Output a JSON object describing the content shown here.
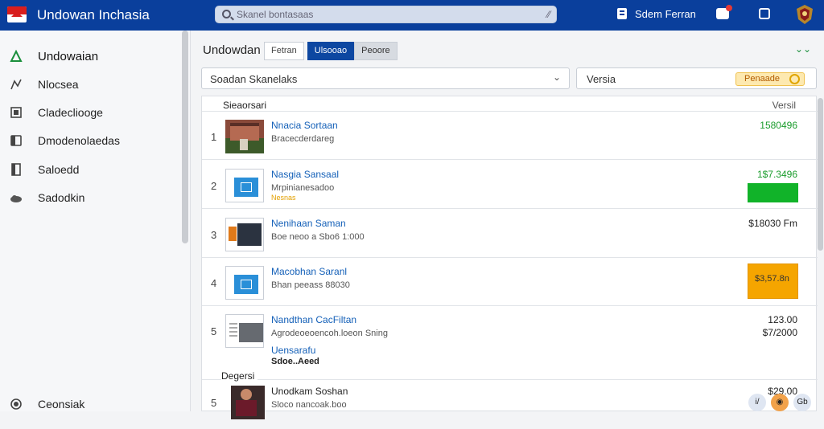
{
  "app": {
    "title": "Undowan Inchasia"
  },
  "search": {
    "placeholder": "Skanel bontasaas",
    "mic_label": "⁄⁄"
  },
  "top_actions": {
    "user_label": "Sdem Ferran"
  },
  "sidebar": {
    "items": [
      {
        "label": "Undowaian",
        "icon": "home-icon",
        "active": true
      },
      {
        "label": "Nlocsea",
        "icon": "chart-icon"
      },
      {
        "label": "Cladecliooge",
        "icon": "box-icon"
      },
      {
        "label": "Dmodenolaedas",
        "icon": "document-icon"
      },
      {
        "label": "Saloedd",
        "icon": "file-icon"
      },
      {
        "label": "Sadodkin",
        "icon": "cloud-icon"
      }
    ],
    "footer_label": "Ceonsiak"
  },
  "main": {
    "breadcrumb": "Undowdan",
    "tabs": [
      {
        "label": "Fetran",
        "state": "default"
      },
      {
        "label": "Ulsooao",
        "state": "active"
      },
      {
        "label": "Peoore",
        "state": "muted"
      }
    ],
    "top_right_icon": "chevron-down-icon",
    "filter": {
      "label": "Soadan Skanelaks"
    },
    "version": {
      "label": "Versia",
      "button_label": "Penaade"
    }
  },
  "table": {
    "headers": {
      "name": "Sieaorsari",
      "version": "Versil"
    },
    "rows": [
      {
        "num": "1",
        "name": "Nnacia Sortaan",
        "desc": "Bracecderdareg",
        "value": "1580496",
        "value_color": "green",
        "thumb": "photo"
      },
      {
        "num": "2",
        "name": "Nasgia Sansaal",
        "desc": "Mrpinianesadoo",
        "tag": "Nesnas",
        "value": "1$7.3496",
        "value_color": "green",
        "thumb": "file",
        "bar": "green"
      },
      {
        "num": "3",
        "name": "Nenihaan Saman",
        "desc": "Boe neoo a Sbo6 1:000",
        "value": "$18030 Fm",
        "value_color": "dark",
        "thumb": "dark"
      },
      {
        "num": "4",
        "name": "Macobhan Saranl",
        "desc": "Bhan peeass 88030",
        "value": "$3,57.8n",
        "value_color": "dark",
        "thumb": "file",
        "bar": "orange"
      },
      {
        "num": "5",
        "name": "Nandthan CacFiltan",
        "desc": "Agrodeoeoencoh.loeon Sning",
        "sub2": "Uensarafu",
        "sub3": "Sdoe..Aeed",
        "value": "123.00",
        "value2": "$7/2000",
        "value_color": "dark",
        "thumb": "gray",
        "corner_label": "Degersi"
      },
      {
        "num": "5",
        "name": "Unodkam Soshan",
        "desc": "Sloco nancoak.boo",
        "value": "$29.00",
        "value_color": "dark",
        "thumb": "person"
      }
    ]
  },
  "bottom_icons": [
    {
      "label": "i/",
      "color": "#dfe6f2"
    },
    {
      "label": "◉",
      "color": "#f2a24a"
    },
    {
      "label": "Gb",
      "color": "#dfe6f2"
    }
  ]
}
